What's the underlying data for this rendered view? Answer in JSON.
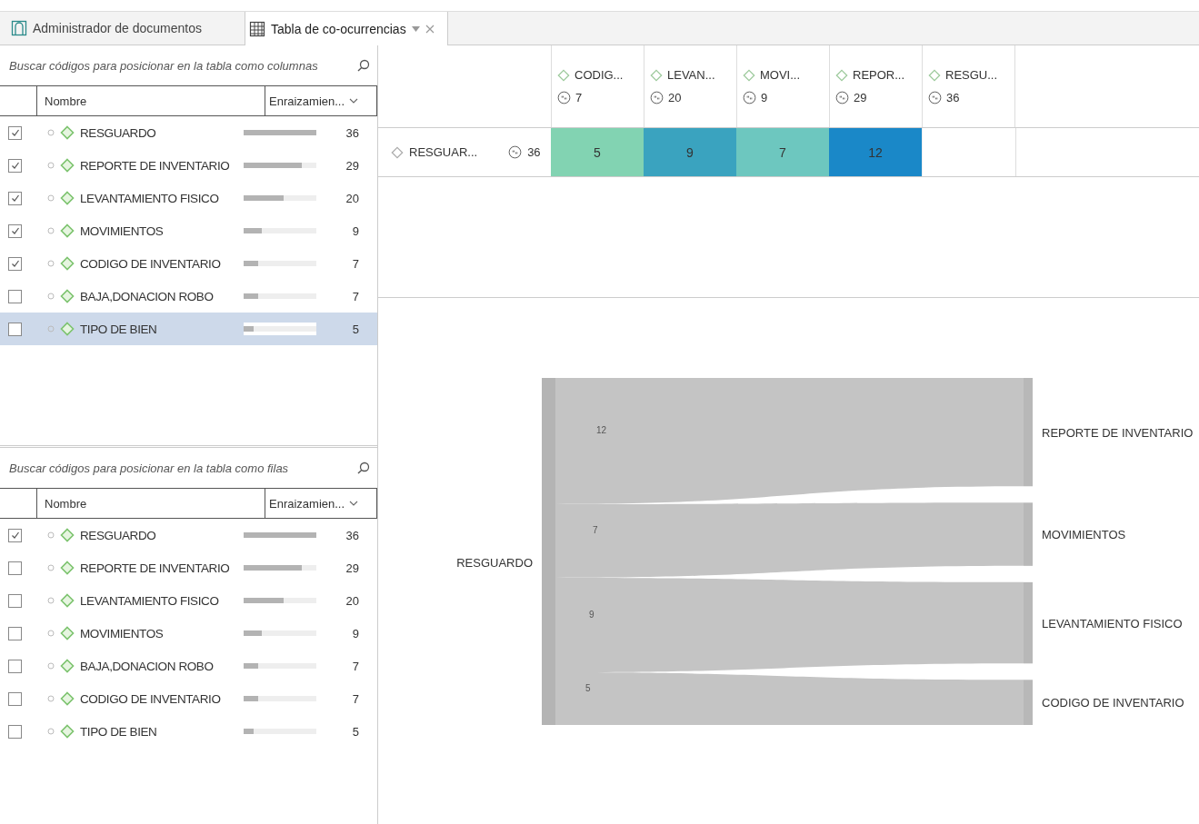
{
  "tabs": [
    {
      "label": "Administrador de documentos",
      "kind": "documents",
      "selected": false
    },
    {
      "label": "Tabla de co-ocurrencias",
      "kind": "table",
      "selected": true
    }
  ],
  "column_codes": {
    "search": {
      "placeholder": "Buscar códigos para posicionar en la tabla como columnas"
    },
    "columns": [
      "Nombre",
      "Enraizamien..."
    ],
    "items": [
      {
        "name": "RESGUARDO",
        "count": "36",
        "level": 1,
        "checked": true,
        "selected": false
      },
      {
        "name": "REPORTE DE INVENTARIO",
        "count": "29",
        "level": 0.8,
        "checked": true,
        "selected": false
      },
      {
        "name": "LEVANTAMIENTO FISICO",
        "count": "20",
        "level": 0.55,
        "checked": true,
        "selected": false
      },
      {
        "name": "MOVIMIENTOS",
        "count": "9",
        "level": 0.25,
        "checked": true,
        "selected": false
      },
      {
        "name": "CODIGO DE INVENTARIO",
        "count": "7",
        "level": 0.2,
        "checked": true,
        "selected": false
      },
      {
        "name": "BAJA,DONACION ROBO",
        "count": "7",
        "level": 0.2,
        "checked": false,
        "selected": false
      },
      {
        "name": "TIPO DE BIEN",
        "count": "5",
        "level": 0.14,
        "checked": false,
        "selected": true
      }
    ]
  },
  "row_codes": {
    "search": {
      "placeholder": "Buscar códigos para posicionar en la tabla como filas"
    },
    "columns": [
      "Nombre",
      "Enraizamien..."
    ],
    "items": [
      {
        "name": "RESGUARDO",
        "count": "36",
        "level": 1,
        "checked": true,
        "selected": false
      },
      {
        "name": "REPORTE DE INVENTARIO",
        "count": "29",
        "level": 0.8,
        "checked": false,
        "selected": false
      },
      {
        "name": "LEVANTAMIENTO FISICO",
        "count": "20",
        "level": 0.55,
        "checked": false,
        "selected": false
      },
      {
        "name": "MOVIMIENTOS",
        "count": "9",
        "level": 0.25,
        "checked": false,
        "selected": false
      },
      {
        "name": "BAJA,DONACION ROBO",
        "count": "7",
        "level": 0.2,
        "checked": false,
        "selected": false
      },
      {
        "name": "CODIGO DE INVENTARIO",
        "count": "7",
        "level": 0.2,
        "checked": false,
        "selected": false
      },
      {
        "name": "TIPO DE BIEN",
        "count": "5",
        "level": 0.14,
        "checked": false,
        "selected": false
      }
    ]
  },
  "cooccurrence_table": {
    "columns": [
      {
        "name": "CODIG...",
        "count": "7"
      },
      {
        "name": "LEVAN...",
        "count": "20"
      },
      {
        "name": "MOVI...",
        "count": "9"
      },
      {
        "name": "REPOR...",
        "count": "29"
      },
      {
        "name": "RESGU...",
        "count": "36"
      }
    ],
    "rows": [
      {
        "name": "RESGUAR...",
        "count": "36",
        "cells": [
          {
            "value": "5",
            "color": "#82d3b2"
          },
          {
            "value": "9",
            "color": "#3aa3bf"
          },
          {
            "value": "7",
            "color": "#6dc7bf"
          },
          {
            "value": "12",
            "color": "#1a88c8"
          }
        ]
      }
    ]
  },
  "sankey": {
    "source": "RESGUARDO",
    "flows": [
      {
        "target": "REPORTE DE INVENTARIO",
        "value": "12"
      },
      {
        "target": "MOVIMIENTOS",
        "value": "7"
      },
      {
        "target": "LEVANTAMIENTO FISICO",
        "value": "9"
      },
      {
        "target": "CODIGO DE INVENTARIO",
        "value": "5"
      }
    ]
  }
}
